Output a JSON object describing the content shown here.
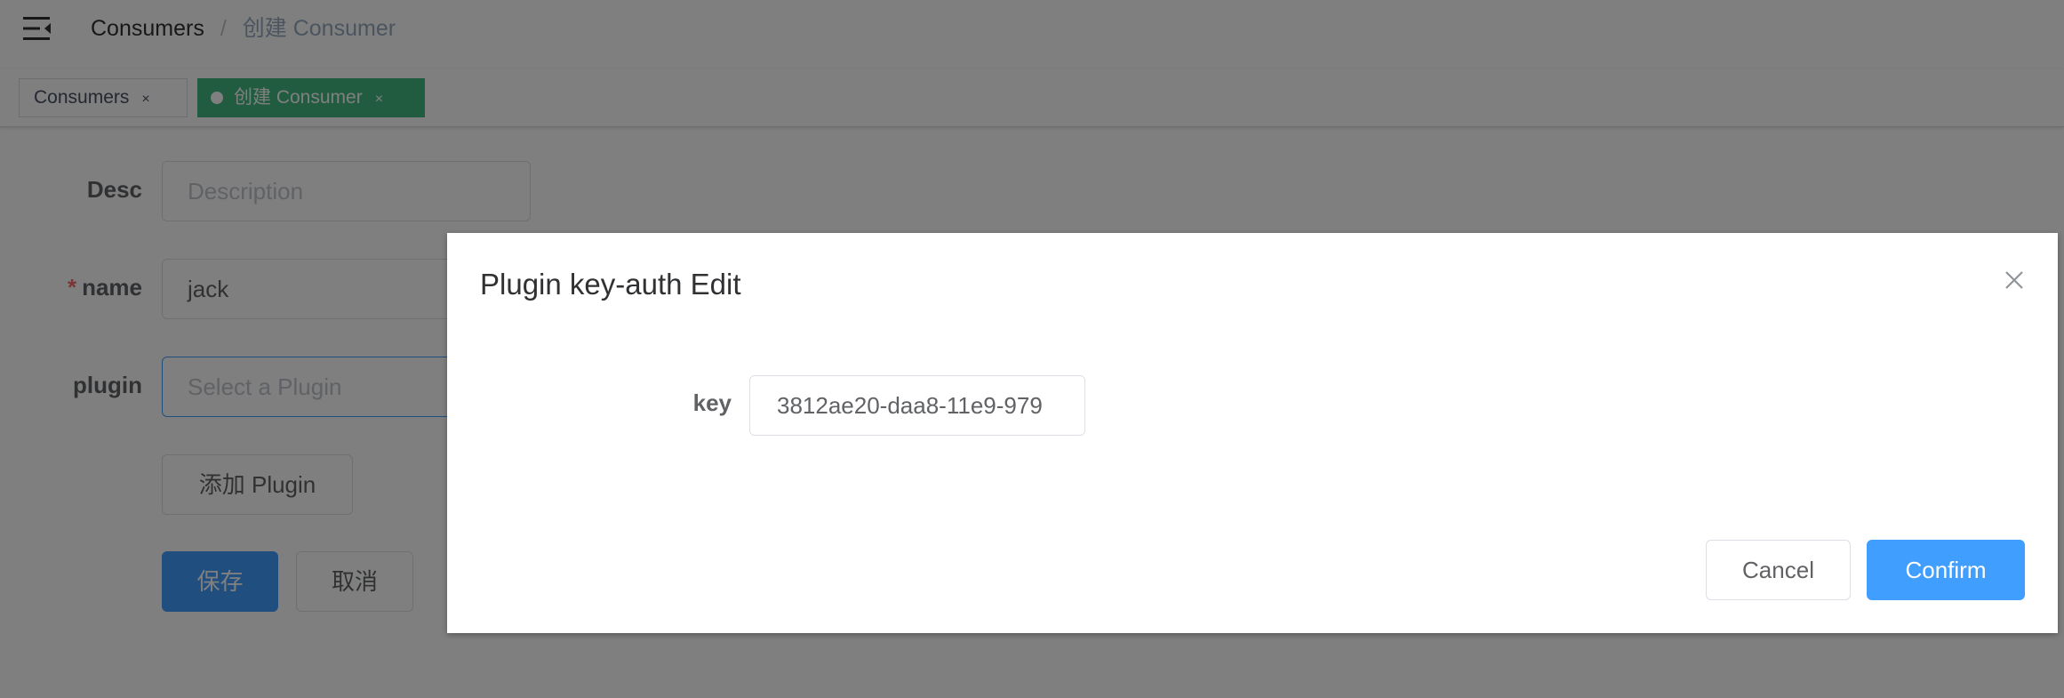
{
  "header": {
    "breadcrumb": [
      "Consumers",
      "/",
      "创建 Consumer"
    ]
  },
  "tags": [
    {
      "label": "Consumers",
      "close": "×",
      "active": false
    },
    {
      "label": "创建 Consumer",
      "close": "×",
      "active": true
    }
  ],
  "form": {
    "desc": {
      "label": "Desc",
      "placeholder": "Description",
      "value": ""
    },
    "name": {
      "required_mark": "*",
      "label": "name",
      "value": "jack"
    },
    "plugin": {
      "label": "plugin",
      "placeholder": "Select a Plugin",
      "value": ""
    },
    "add_plugin_label": "添加 Plugin",
    "save_label": "保存",
    "cancel_label": "取消"
  },
  "dialog": {
    "title": "Plugin key-auth Edit",
    "key_label": "key",
    "key_value": "3812ae20-daa8-11e9-979",
    "cancel_label": "Cancel",
    "confirm_label": "Confirm"
  },
  "colors": {
    "primary": "#409eff",
    "tag_active": "#42b983",
    "required": "#f56c6c",
    "overlay": "rgba(0,0,0,0.5)"
  },
  "icons": {
    "hamburger": "hamburger-icon",
    "close": "close-icon",
    "tag_dot": "dot-icon"
  }
}
